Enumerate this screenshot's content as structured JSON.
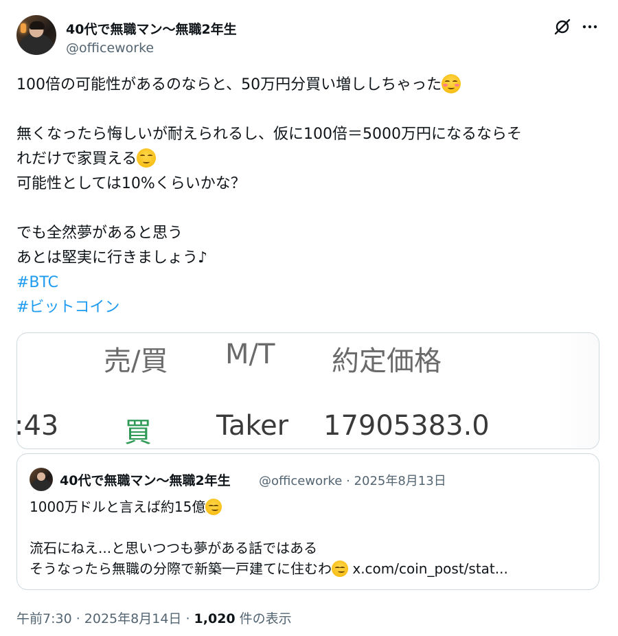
{
  "author": {
    "display_name": "40代で無職マン〜無職2年生",
    "handle": "@officeworke"
  },
  "post": {
    "line1": "100倍の可能性があるのならと、50万円分買い増ししちゃった",
    "line2": "無くなったら悔しいが耐えられるし、仮に100倍＝5000万円になるならそ",
    "line3": "れだけで家買える",
    "line4": "可能性としては10%くらいかな？",
    "line5": "でも全然夢があると思う",
    "line6": "あとは堅実に行きましょう♪",
    "hashtags": [
      "#BTC",
      "#ビットコイン"
    ]
  },
  "media": {
    "headers": [
      "売/買",
      "M/T",
      "約定価格"
    ],
    "row": {
      "time_fragment": ":43",
      "side": "買",
      "type": "Taker",
      "price": "17905383.0"
    }
  },
  "quote": {
    "display_name": "40代で無職マン〜無職2年生",
    "meta": "@officeworke · 2025年8月13日",
    "line1": "1000万ドルと言えば約15億",
    "line2": "流石にねえ...と思いつつも夢がある話ではある",
    "line3": "そうなったら無職の分際で新築一戸建てに住むわ",
    "link": " x.com/coin_post/stat..."
  },
  "footer": {
    "time_date": "午前7:30 · 2025年8月14日 · ",
    "views_count": "1,020",
    "views_label": " 件の表示"
  },
  "colors": {
    "accent": "#1d9bf0",
    "secondary_text": "#536471",
    "buy_green": "#2e9a55"
  },
  "icons": [
    "grok-icon",
    "more-icon",
    "smiling-blush-emoji",
    "smirk-emoji",
    "thinking-emoji",
    "rofl-emoji"
  ]
}
